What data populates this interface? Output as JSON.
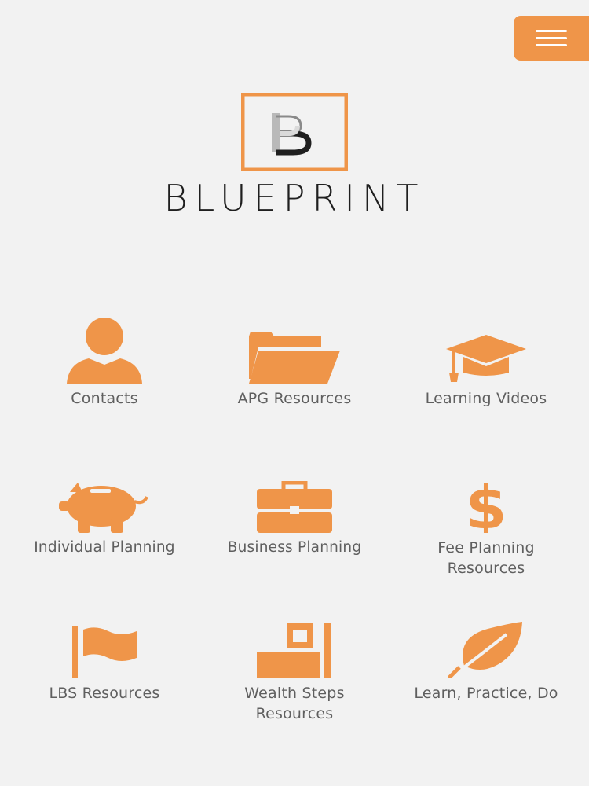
{
  "header": {
    "menu_icon": "hamburger-icon",
    "brand": "BLUEPRINT",
    "logo_letter": "B"
  },
  "colors": {
    "accent": "#ef9549",
    "label": "#5f5f5f",
    "ink": "#1f1f1f",
    "background": "#f2f2f2"
  },
  "tiles": [
    {
      "label": "Contacts",
      "icon": "person-icon"
    },
    {
      "label": "APG Resources",
      "icon": "folder-icon"
    },
    {
      "label": "Learning Videos",
      "icon": "graduation-cap-icon"
    },
    {
      "label": "Individual Planning",
      "icon": "piggy-bank-icon"
    },
    {
      "label": "Business Planning",
      "icon": "briefcase-icon"
    },
    {
      "label": "Fee Planning\nResources",
      "icon": "dollar-icon"
    },
    {
      "label": "LBS Resources",
      "icon": "flag-icon"
    },
    {
      "label": "Wealth Steps\nResources",
      "icon": "steps-icon"
    },
    {
      "label": "Learn, Practice, Do",
      "icon": "leaf-icon"
    }
  ]
}
